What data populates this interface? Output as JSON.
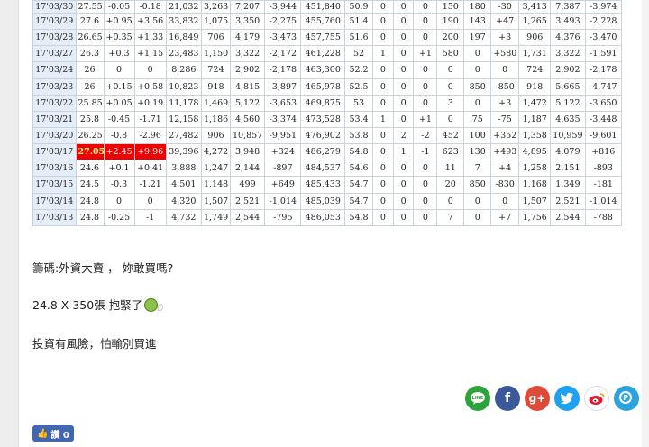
{
  "table": {
    "rows": [
      [
        "17'03/30",
        "27.55",
        "-0.05",
        "-0.18",
        "21,032",
        "3,263",
        "7,207",
        "-3,944",
        "451,840",
        "50.9",
        "0",
        "0",
        "0",
        "150",
        "180",
        "-30",
        "3,413",
        "7,387",
        "-3,974"
      ],
      [
        "17'03/29",
        "27.6",
        "+0.95",
        "+3.56",
        "33,832",
        "1,075",
        "3,350",
        "-2,275",
        "455,760",
        "51.4",
        "0",
        "0",
        "0",
        "190",
        "143",
        "+47",
        "1,265",
        "3,493",
        "-2,228"
      ],
      [
        "17'03/28",
        "26.65",
        "+0.35",
        "+1.33",
        "16,849",
        "706",
        "4,179",
        "-3,473",
        "457,755",
        "51.6",
        "0",
        "0",
        "0",
        "200",
        "197",
        "+3",
        "906",
        "4,376",
        "-3,470"
      ],
      [
        "17'03/27",
        "26.3",
        "+0.3",
        "+1.15",
        "23,483",
        "1,150",
        "3,322",
        "-2,172",
        "461,228",
        "52",
        "1",
        "0",
        "+1",
        "580",
        "0",
        "+580",
        "1,731",
        "3,322",
        "-1,591"
      ],
      [
        "17'03/24",
        "26",
        "0",
        "0",
        "8,286",
        "724",
        "2,902",
        "-2,178",
        "463,300",
        "52.2",
        "0",
        "0",
        "0",
        "0",
        "0",
        "0",
        "724",
        "2,902",
        "-2,178"
      ],
      [
        "17'03/23",
        "26",
        "+0.15",
        "+0.58",
        "10,823",
        "918",
        "4,815",
        "-3,897",
        "465,978",
        "52.5",
        "0",
        "0",
        "0",
        "0",
        "850",
        "-850",
        "918",
        "5,665",
        "-4,747"
      ],
      [
        "17'03/22",
        "25.85",
        "+0.05",
        "+0.19",
        "11,178",
        "1,469",
        "5,122",
        "-3,653",
        "469,875",
        "53",
        "0",
        "0",
        "0",
        "3",
        "0",
        "+3",
        "1,472",
        "5,122",
        "-3,650"
      ],
      [
        "17'03/21",
        "25.8",
        "-0.45",
        "-1.71",
        "12,158",
        "1,186",
        "4,560",
        "-3,374",
        "473,528",
        "53.4",
        "1",
        "0",
        "+1",
        "0",
        "75",
        "-75",
        "1,187",
        "4,635",
        "-3,448"
      ],
      [
        "17'03/20",
        "26.25",
        "-0.8",
        "-2.96",
        "27,482",
        "906",
        "10,857",
        "-9,951",
        "476,902",
        "53.8",
        "0",
        "2",
        "-2",
        "452",
        "100",
        "+352",
        "1,358",
        "10,959",
        "-9,601"
      ],
      [
        "17'03/17",
        "27.05",
        "+2.45",
        "+9.96",
        "39,396",
        "4,272",
        "3,948",
        "+324",
        "486,279",
        "54.8",
        "0",
        "1",
        "-1",
        "623",
        "130",
        "+493",
        "4,895",
        "4,079",
        "+816"
      ],
      [
        "17'03/16",
        "24.6",
        "+0.1",
        "+0.41",
        "3,888",
        "1,247",
        "2,144",
        "-897",
        "484,537",
        "54.6",
        "0",
        "0",
        "0",
        "11",
        "7",
        "+4",
        "1,258",
        "2,151",
        "-893"
      ],
      [
        "17'03/15",
        "24.5",
        "-0.3",
        "-1.21",
        "4,501",
        "1,148",
        "499",
        "+649",
        "485,433",
        "54.7",
        "0",
        "0",
        "0",
        "20",
        "850",
        "-830",
        "1,168",
        "1,349",
        "-181"
      ],
      [
        "17'03/14",
        "24.8",
        "0",
        "0",
        "4,320",
        "1,507",
        "2,521",
        "-1,014",
        "485,039",
        "54.7",
        "0",
        "0",
        "0",
        "0",
        "0",
        "0",
        "1,507",
        "2,521",
        "-1,014"
      ],
      [
        "17'03/13",
        "24.8",
        "-0.25",
        "-1",
        "4,732",
        "1,749",
        "2,544",
        "-795",
        "486,053",
        "54.8",
        "0",
        "0",
        "0",
        "7",
        "0",
        "+7",
        "1,756",
        "2,544",
        "-788"
      ]
    ]
  },
  "post": {
    "line1": "籌碼:外資大賣 ， 妳敢買嗎?",
    "line2": "24.8 X 350張 抱緊了",
    "line3": "投資有風險，怕輸別買進"
  },
  "share": {
    "line_glyph": "LINE",
    "facebook_glyph": "f",
    "googleplus_glyph": "g+",
    "twitter_glyph": "t",
    "weibo_glyph": "微",
    "plurk_glyph": "P"
  },
  "like": {
    "icon": "👍",
    "label": "讚 0"
  },
  "colors": {
    "positive": "#e02020",
    "negative": "#1e8a3e",
    "highlight": "#ee0000",
    "row_date_bg": "#e5eef8"
  }
}
